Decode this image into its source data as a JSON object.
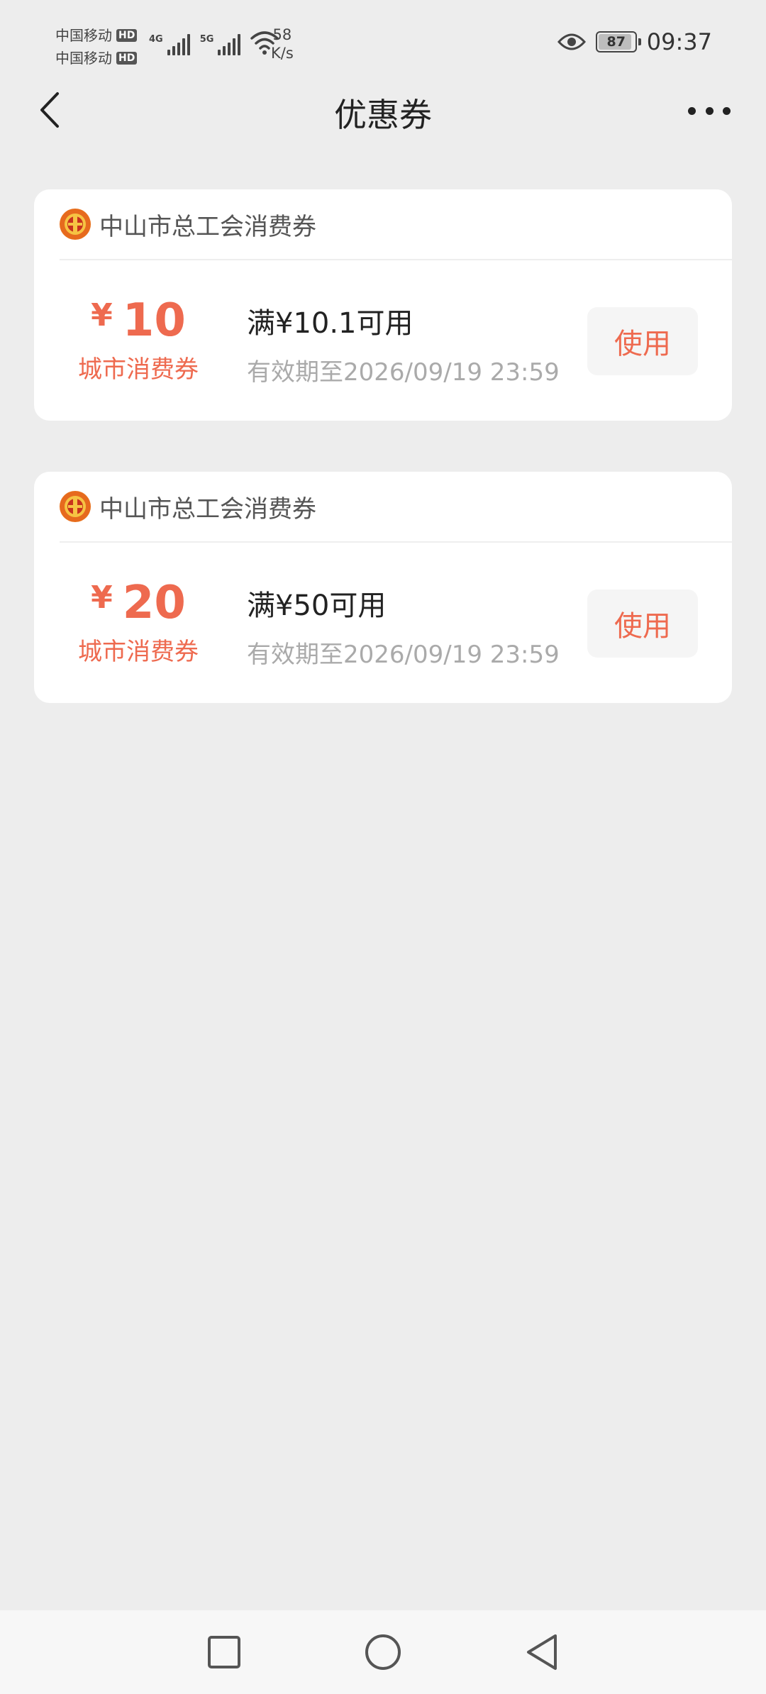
{
  "status_bar": {
    "carrier_1": "中国移动",
    "carrier_2": "中国移动",
    "hd_badge": "HD",
    "net_1": "4G",
    "net_2": "5G",
    "speed_value": "58",
    "speed_unit": "K/s",
    "battery": "87",
    "time": "09:37"
  },
  "nav": {
    "title": "优惠券"
  },
  "coupons": [
    {
      "issuer": "中山市总工会消费券",
      "currency": "¥",
      "amount": "10",
      "type": "城市消费券",
      "condition": "满¥10.1可用",
      "validity": "有效期至2026/09/19 23:59",
      "button": "使用"
    },
    {
      "issuer": "中山市总工会消费券",
      "currency": "¥",
      "amount": "20",
      "type": "城市消费券",
      "condition": "满¥50可用",
      "validity": "有效期至2026/09/19 23:59",
      "button": "使用"
    }
  ],
  "colors": {
    "accent": "#ee6a4f",
    "background": "#ededed"
  }
}
